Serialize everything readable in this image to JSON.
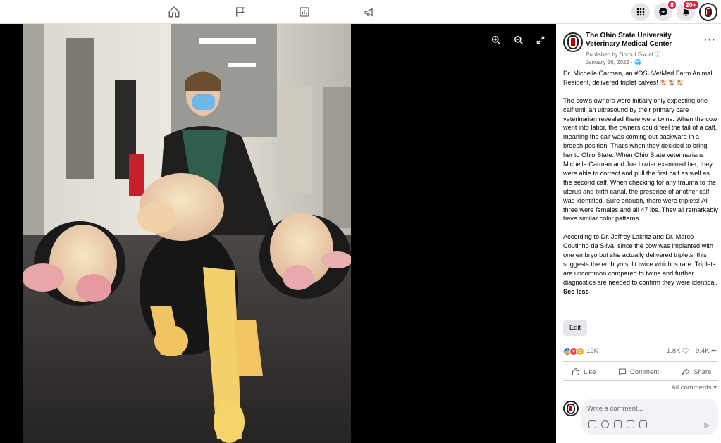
{
  "topnav": {
    "items": [
      "home-icon",
      "flag-icon",
      "chart-icon",
      "megaphone-icon"
    ],
    "messenger_badge": "8",
    "notifications_badge": "20+"
  },
  "viewer": {
    "tools": [
      "zoom-in-icon",
      "zoom-out-icon",
      "fullscreen-icon"
    ]
  },
  "post": {
    "page_name": "The Ohio State University Veterinary Medical Center",
    "published_by": "Published by Sprout Social",
    "date": "January 26, 2022",
    "paragraphs": [
      "Dr. Michelle Carman, an #OSUVetMed Farm Animal Resident, delivered triplet calves! 🐮🐮🐮",
      "The cow's owners were initially only expecting one calf until an ultrasound by their primary care veterinarian revealed there were twins. When the cow went into labor, the owners could feel the tail of a calf, meaning the calf was coming out backward in a breech position. That's when they decided to bring her to Ohio State. When Ohio State veterinarians Michelle Carman and Joe Lozier examined her, they were able to correct and pull the first calf as well as the second calf. When checking for any trauma to the uterus and birth canal, the presence of another calf was identified. Sure enough, there were triplets! All three were females and all 47 lbs. They all remarkably have similar color patterns.",
      "According to Dr. Jeffrey Lakritz and Dr. Marco Coutinho da Silva, since the cow was implanted with one embryo but she actually delivered triplets, this suggests the embryo split twice which is rare. Triplets are uncommon compared to twins and further diagnostics are needed to confirm they were identical."
    ],
    "see_less": "See less",
    "edit_label": "Edit",
    "reaction_count": "12K",
    "comment_count": "1.8K",
    "share_count": "9.4K",
    "like_label": "Like",
    "comment_label": "Comment",
    "share_label": "Share",
    "all_comments_label": "All comments",
    "comment_placeholder": "Write a comment..."
  },
  "colors": {
    "accent": "#1877f2",
    "badge": "#e41e3f",
    "love": "#f33e58",
    "wow": "#f7b125"
  }
}
